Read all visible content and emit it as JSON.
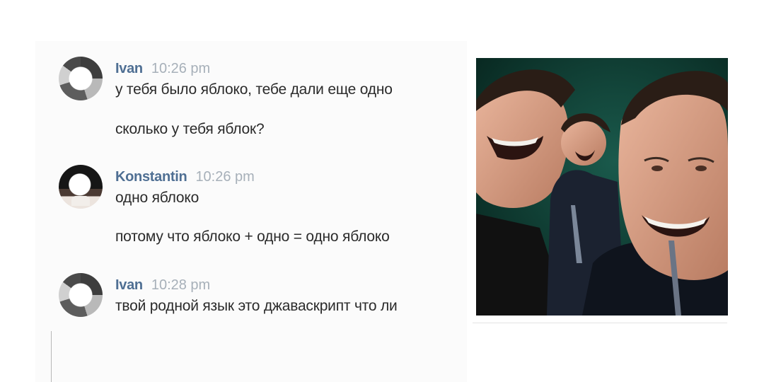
{
  "messages": [
    {
      "author": "Ivan",
      "time": "10:26 pm",
      "lines": [
        "у тебя было яблоко, тебе дали еще одно",
        "сколько у тебя яблок?"
      ]
    },
    {
      "author": "Konstantin",
      "time": "10:26 pm",
      "lines": [
        "одно яблоко",
        "потому что яблоко + одно = одно яблоко"
      ]
    },
    {
      "author": "Ivan",
      "time": "10:28 pm",
      "lines": [
        "твой родной язык это джаваскрипт что ли"
      ]
    }
  ],
  "colors": {
    "author_name": "#4f6f93",
    "timestamp": "#a7b0b9",
    "message_text": "#2b2b2b",
    "meme_background": "#0d3a32"
  },
  "icons": [
    "avatar-ivan-icon",
    "avatar-konstantin-icon",
    "laughing-man-image"
  ]
}
